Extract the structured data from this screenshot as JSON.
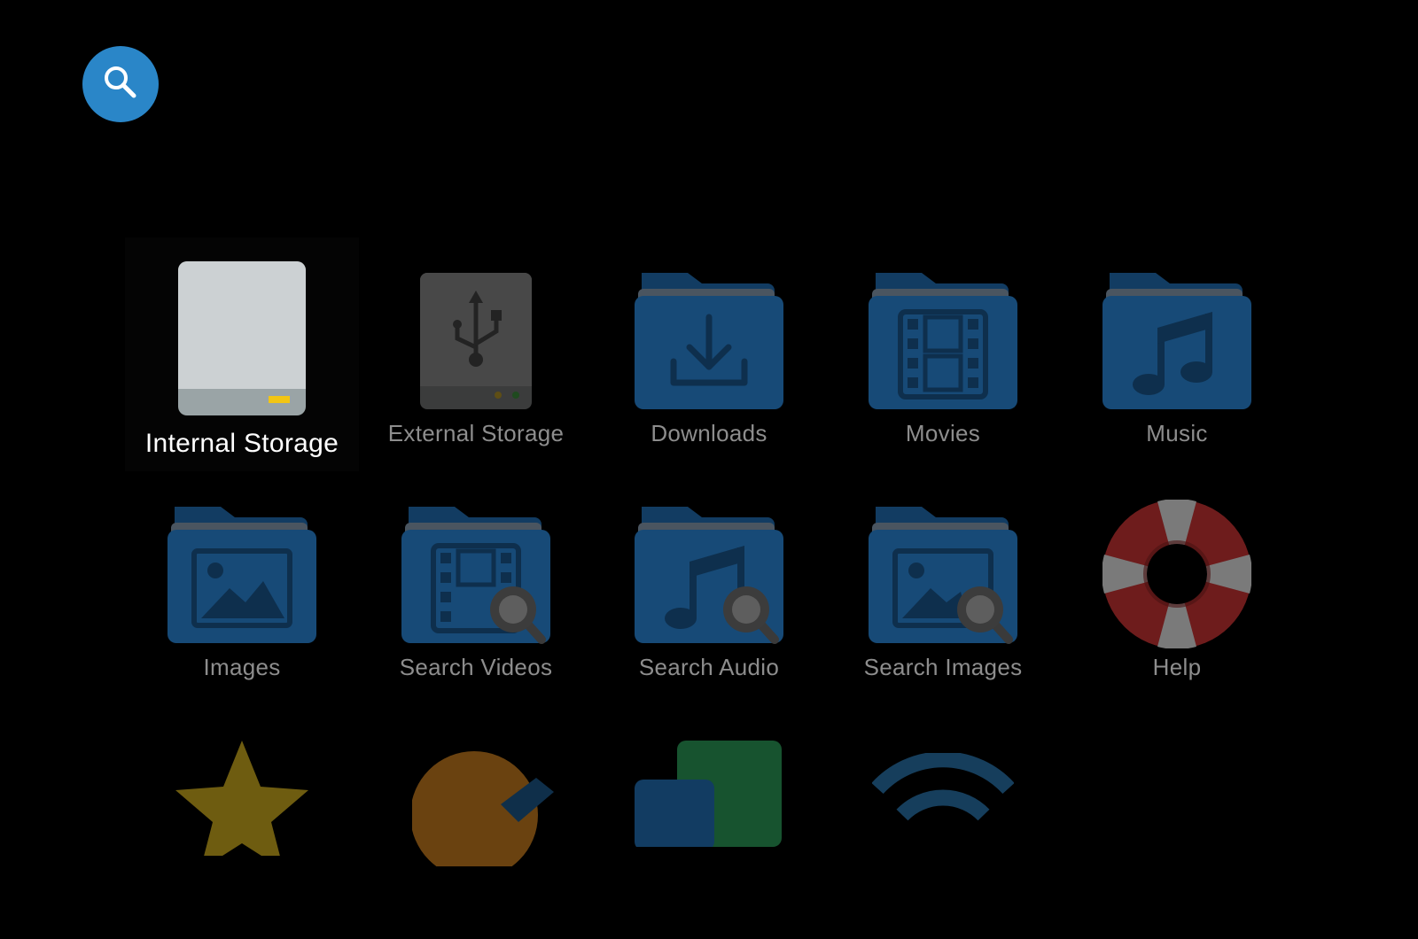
{
  "toolbar": {
    "search_icon": "search-icon"
  },
  "grid": {
    "row1": [
      {
        "label": "Internal Storage",
        "icon": "hard-drive-icon",
        "focused": true
      },
      {
        "label": "External Storage",
        "icon": "usb-drive-icon"
      },
      {
        "label": "Downloads",
        "icon": "folder-download-icon"
      },
      {
        "label": "Movies",
        "icon": "folder-film-icon"
      },
      {
        "label": "Music",
        "icon": "folder-music-icon"
      }
    ],
    "row2": [
      {
        "label": "Images",
        "icon": "folder-image-icon"
      },
      {
        "label": "Search Videos",
        "icon": "search-videos-icon"
      },
      {
        "label": "Search Audio",
        "icon": "search-audio-icon"
      },
      {
        "label": "Search Images",
        "icon": "search-images-icon"
      },
      {
        "label": "Help",
        "icon": "lifebuoy-icon"
      }
    ],
    "row3": [
      {
        "icon": "star-icon"
      },
      {
        "icon": "clock-icon"
      },
      {
        "icon": "copy-icon"
      },
      {
        "icon": "wifi-icon"
      }
    ]
  },
  "colors": {
    "accent": "#2a86c8",
    "folder": "#174a77",
    "folder_tab": "#123c62"
  }
}
